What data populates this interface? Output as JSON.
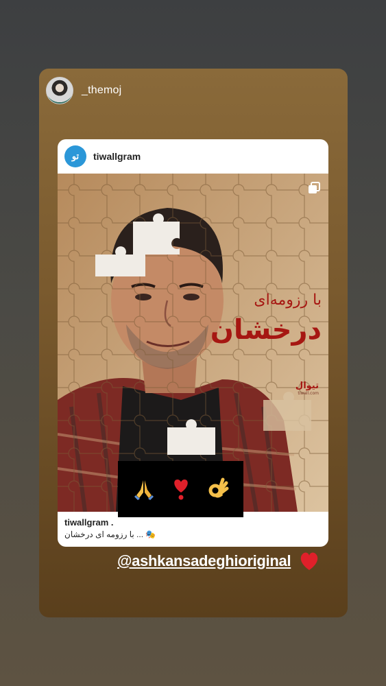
{
  "story": {
    "username": "_themoj",
    "avatar_icon": "user-avatar"
  },
  "post": {
    "account": "tiwallgram",
    "logo_text": "تو",
    "logo_color": "#2b97d8",
    "image": {
      "title_small": "با رزومه‌ای",
      "title_big": "درخشان",
      "brand": "تیوال",
      "brand_url": "tiwall.com",
      "multi_icon": "carousel-icon"
    },
    "caption": {
      "account": "tiwallgram .",
      "text": "با رزومه ای درخشان ... 🎭"
    }
  },
  "sticker": {
    "emojis": [
      "praying-hands-icon",
      "heart-exclamation-icon",
      "ok-hand-icon"
    ]
  },
  "mention": {
    "text": "@ashkansadeghioriginal",
    "icon": "red-heart-icon"
  },
  "colors": {
    "story_bg": "#7a5a2e",
    "accent_red": "#a61712",
    "heart_red": "#e0202a"
  }
}
